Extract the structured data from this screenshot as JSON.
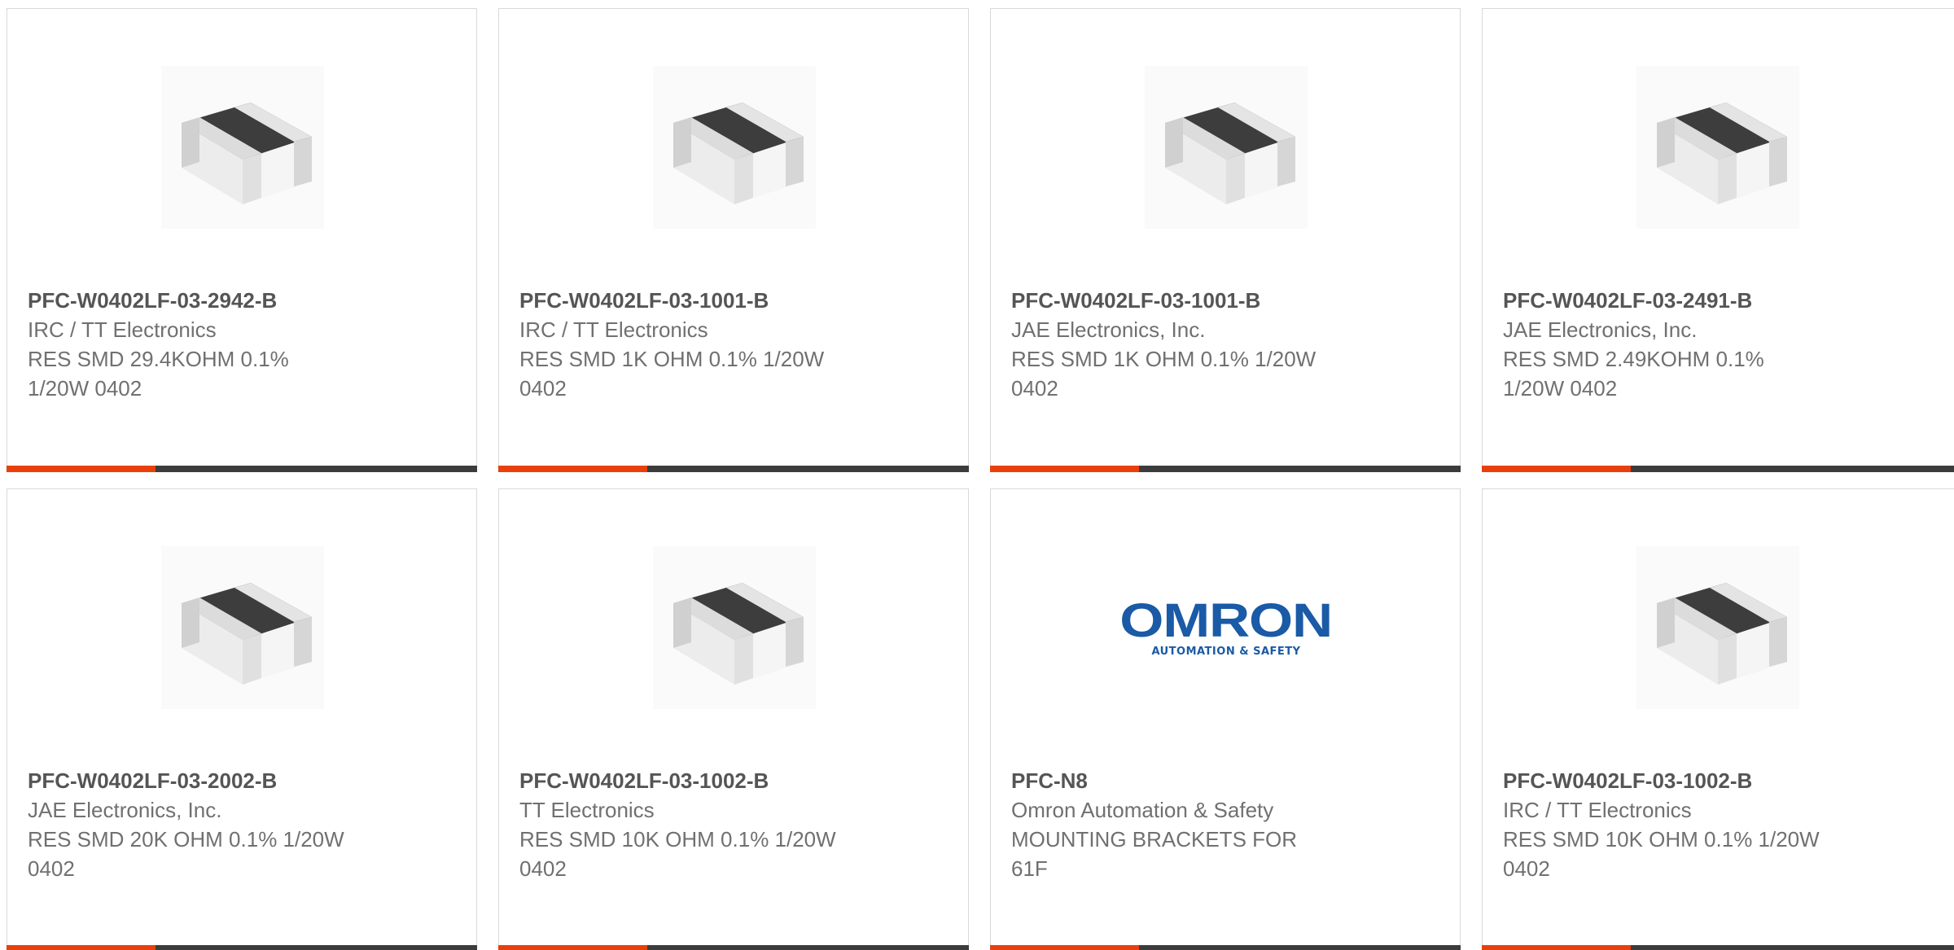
{
  "products": [
    {
      "part_number": "PFC-W0402LF-03-2942-B",
      "manufacturer": "IRC / TT Electronics",
      "description_line1": "RES SMD 29.4KOHM 0.1%",
      "description_line2": "1/20W 0402",
      "image": "smd-resistor-icon"
    },
    {
      "part_number": "PFC-W0402LF-03-1001-B",
      "manufacturer": "IRC / TT Electronics",
      "description_line1": "RES SMD 1K OHM 0.1% 1/20W",
      "description_line2": "0402",
      "image": "smd-resistor-icon"
    },
    {
      "part_number": "PFC-W0402LF-03-1001-B",
      "manufacturer": "JAE Electronics, Inc.",
      "description_line1": "RES SMD 1K OHM 0.1% 1/20W",
      "description_line2": "0402",
      "image": "smd-resistor-icon"
    },
    {
      "part_number": "PFC-W0402LF-03-2491-B",
      "manufacturer": "JAE Electronics, Inc.",
      "description_line1": "RES SMD 2.49KOHM 0.1%",
      "description_line2": "1/20W 0402",
      "image": "smd-resistor-icon"
    },
    {
      "part_number": "PFC-W0402LF-03-2002-B",
      "manufacturer": "JAE Electronics, Inc.",
      "description_line1": "RES SMD 20K OHM 0.1% 1/20W",
      "description_line2": "0402",
      "image": "smd-resistor-icon"
    },
    {
      "part_number": "PFC-W0402LF-03-1002-B",
      "manufacturer": "TT Electronics",
      "description_line1": "RES SMD 10K OHM 0.1% 1/20W",
      "description_line2": "0402",
      "image": "smd-resistor-icon"
    },
    {
      "part_number": "PFC-N8",
      "manufacturer": "Omron Automation & Safety",
      "description_line1": "MOUNTING BRACKETS FOR",
      "description_line2": "61F",
      "image": "omron-logo",
      "logo_word": "OMRON",
      "logo_subtitle": "AUTOMATION & SAFETY"
    },
    {
      "part_number": "PFC-W0402LF-03-1002-B",
      "manufacturer": "IRC / TT Electronics",
      "description_line1": "RES SMD 10K OHM 0.1% 1/20W",
      "description_line2": "0402",
      "image": "smd-resistor-icon"
    }
  ],
  "colors": {
    "accent": "#e8400c",
    "bar": "#3c3c3c",
    "text": "#707070",
    "omron_blue": "#1a5aa6"
  }
}
